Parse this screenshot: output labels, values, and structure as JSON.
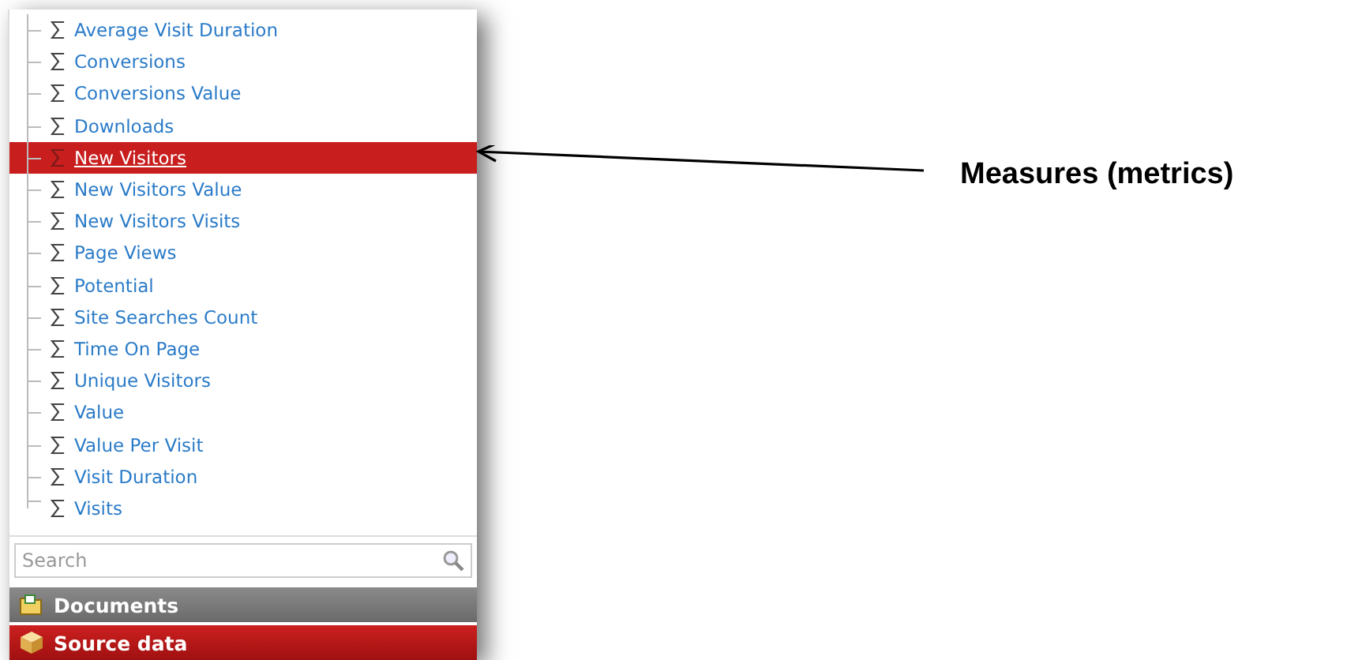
{
  "measures": [
    {
      "label": "Average Visit Duration",
      "selected": false
    },
    {
      "label": "Conversions",
      "selected": false
    },
    {
      "label": "Conversions Value",
      "selected": false
    },
    {
      "label": "Downloads",
      "selected": false
    },
    {
      "label": "New Visitors",
      "selected": true
    },
    {
      "label": "New Visitors Value",
      "selected": false
    },
    {
      "label": "New Visitors Visits",
      "selected": false
    },
    {
      "label": "Page Views",
      "selected": false
    },
    {
      "label": "Potential",
      "selected": false
    },
    {
      "label": "Site Searches Count",
      "selected": false
    },
    {
      "label": "Time On Page",
      "selected": false
    },
    {
      "label": "Unique Visitors",
      "selected": false
    },
    {
      "label": "Value",
      "selected": false
    },
    {
      "label": "Value Per Visit",
      "selected": false
    },
    {
      "label": "Visit Duration",
      "selected": false
    },
    {
      "label": "Visits",
      "selected": false
    }
  ],
  "search": {
    "placeholder": "Search"
  },
  "sections": [
    {
      "label": "Documents",
      "kind": "documents",
      "selected": false
    },
    {
      "label": "Source data",
      "kind": "source",
      "selected": true
    }
  ],
  "callout": {
    "label": "Measures (metrics)"
  }
}
